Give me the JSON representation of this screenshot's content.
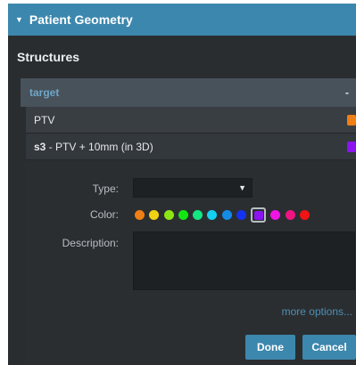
{
  "panel": {
    "title": "Patient Geometry",
    "expanded": true
  },
  "structures": {
    "title": "Structures",
    "group": {
      "label": "target",
      "collapse_label": "-"
    },
    "items": [
      {
        "prefix": "",
        "name": "PTV",
        "color": "#f07f14"
      },
      {
        "prefix": "s3",
        "name": " - PTV + 10mm (in 3D)",
        "color": "#8c14f0"
      }
    ]
  },
  "editor": {
    "type_label": "Type:",
    "type_value": "",
    "color_label": "Color:",
    "palette": [
      "#f07f14",
      "#f0d214",
      "#8ce614",
      "#14e614",
      "#14e682",
      "#14d2f0",
      "#148ce6",
      "#1432f0",
      "#8c14f0",
      "#f014e6",
      "#f01482",
      "#f01414"
    ],
    "selected_color_index": 8,
    "description_label": "Description:",
    "description_value": "",
    "more_options": "more options...",
    "done_label": "Done",
    "cancel_label": "Cancel"
  }
}
